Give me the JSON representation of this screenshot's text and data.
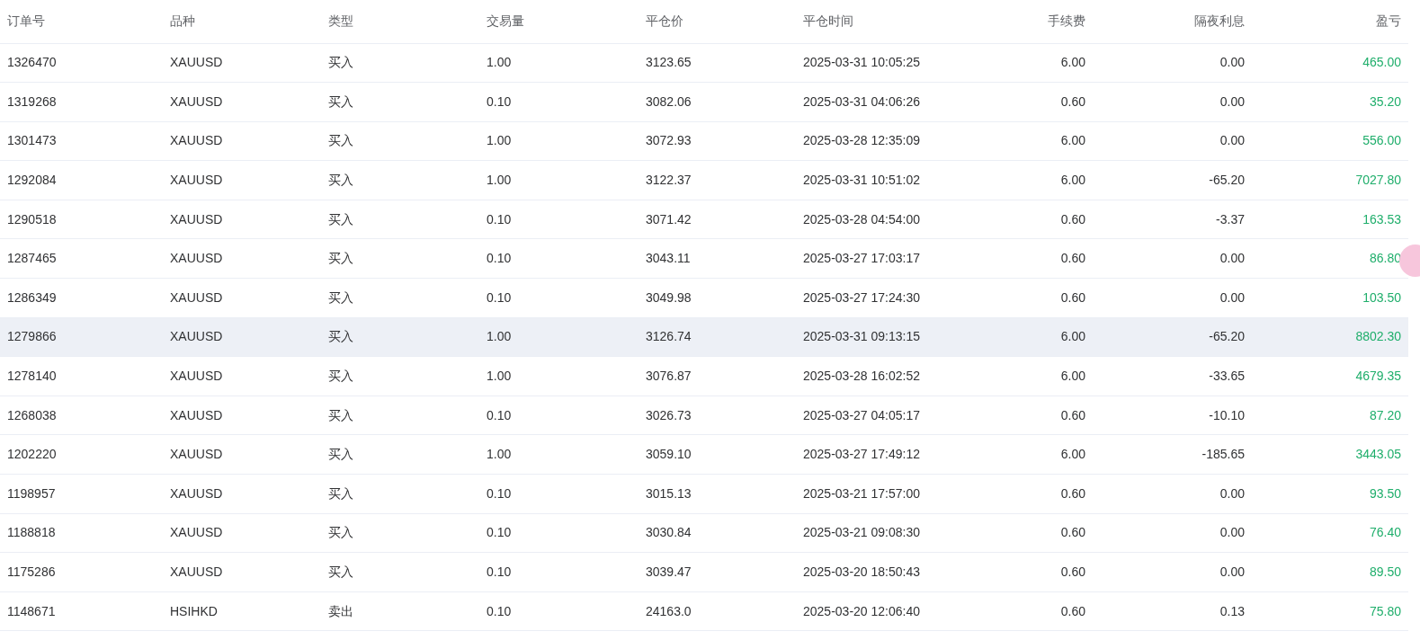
{
  "table": {
    "columns": [
      "订单号",
      "品种",
      "类型",
      "交易量",
      "平仓价",
      "平仓时间",
      "手续费",
      "隔夜利息",
      "盈亏"
    ],
    "rows": [
      {
        "selected": false,
        "cells": [
          "1326470",
          "XAUUSD",
          "买入",
          "1.00",
          "3123.65",
          "2025-03-31 10:05:25",
          "6.00",
          "0.00",
          "465.00"
        ]
      },
      {
        "selected": false,
        "cells": [
          "1319268",
          "XAUUSD",
          "买入",
          "0.10",
          "3082.06",
          "2025-03-31 04:06:26",
          "0.60",
          "0.00",
          "35.20"
        ]
      },
      {
        "selected": false,
        "cells": [
          "1301473",
          "XAUUSD",
          "买入",
          "1.00",
          "3072.93",
          "2025-03-28 12:35:09",
          "6.00",
          "0.00",
          "556.00"
        ]
      },
      {
        "selected": false,
        "cells": [
          "1292084",
          "XAUUSD",
          "买入",
          "1.00",
          "3122.37",
          "2025-03-31 10:51:02",
          "6.00",
          "-65.20",
          "7027.80"
        ]
      },
      {
        "selected": false,
        "cells": [
          "1290518",
          "XAUUSD",
          "买入",
          "0.10",
          "3071.42",
          "2025-03-28 04:54:00",
          "0.60",
          "-3.37",
          "163.53"
        ]
      },
      {
        "selected": false,
        "cells": [
          "1287465",
          "XAUUSD",
          "买入",
          "0.10",
          "3043.11",
          "2025-03-27 17:03:17",
          "0.60",
          "0.00",
          "86.80"
        ]
      },
      {
        "selected": false,
        "cells": [
          "1286349",
          "XAUUSD",
          "买入",
          "0.10",
          "3049.98",
          "2025-03-27 17:24:30",
          "0.60",
          "0.00",
          "103.50"
        ]
      },
      {
        "selected": true,
        "cells": [
          "1279866",
          "XAUUSD",
          "买入",
          "1.00",
          "3126.74",
          "2025-03-31 09:13:15",
          "6.00",
          "-65.20",
          "8802.30"
        ]
      },
      {
        "selected": false,
        "cells": [
          "1278140",
          "XAUUSD",
          "买入",
          "1.00",
          "3076.87",
          "2025-03-28 16:02:52",
          "6.00",
          "-33.65",
          "4679.35"
        ]
      },
      {
        "selected": false,
        "cells": [
          "1268038",
          "XAUUSD",
          "买入",
          "0.10",
          "3026.73",
          "2025-03-27 04:05:17",
          "0.60",
          "-10.10",
          "87.20"
        ]
      },
      {
        "selected": false,
        "cells": [
          "1202220",
          "XAUUSD",
          "买入",
          "1.00",
          "3059.10",
          "2025-03-27 17:49:12",
          "6.00",
          "-185.65",
          "3443.05"
        ]
      },
      {
        "selected": false,
        "cells": [
          "1198957",
          "XAUUSD",
          "买入",
          "0.10",
          "3015.13",
          "2025-03-21 17:57:00",
          "0.60",
          "0.00",
          "93.50"
        ]
      },
      {
        "selected": false,
        "cells": [
          "1188818",
          "XAUUSD",
          "买入",
          "0.10",
          "3030.84",
          "2025-03-21 09:08:30",
          "0.60",
          "0.00",
          "76.40"
        ]
      },
      {
        "selected": false,
        "cells": [
          "1175286",
          "XAUUSD",
          "买入",
          "0.10",
          "3039.47",
          "2025-03-20 18:50:43",
          "0.60",
          "0.00",
          "89.50"
        ]
      },
      {
        "selected": false,
        "cells": [
          "1148671",
          "HSIHKD",
          "卖出",
          "0.10",
          "24163.0",
          "2025-03-20 12:06:40",
          "0.60",
          "0.13",
          "75.80"
        ]
      }
    ]
  }
}
